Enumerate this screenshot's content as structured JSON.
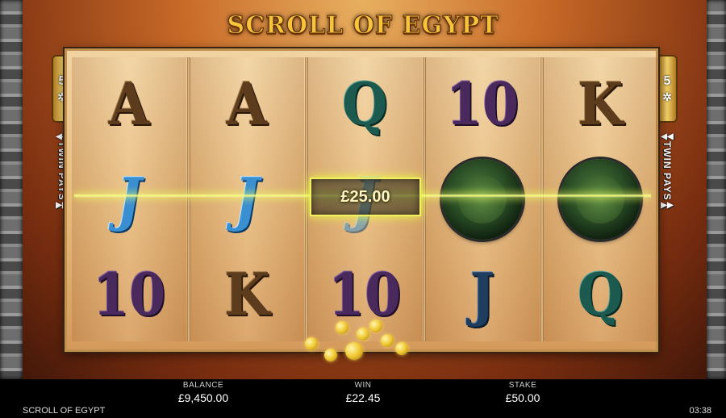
{
  "game": {
    "title": "SCROLL OF EGYPT",
    "lines_count": "5",
    "lines_star": "✲",
    "twin_pays_label": "TWIN PAYS",
    "arrow_up": "◀◀",
    "arrow_down": "▶▶"
  },
  "reels": [
    [
      "A",
      "J",
      "10"
    ],
    [
      "A",
      "J",
      "K"
    ],
    [
      "Q",
      "J",
      "10"
    ],
    [
      "10",
      "scarab-medallion",
      "J"
    ],
    [
      "K",
      "scarab-medallion",
      "Q"
    ]
  ],
  "win_popup": {
    "amount": "£25.00"
  },
  "hud": {
    "balance_label": "BALANCE",
    "balance_value": "£9,450.00",
    "win_label": "WIN",
    "win_value": "£22.45",
    "stake_label": "STAKE",
    "stake_value": "£50.00",
    "game_name": "SCROLL OF EGYPT",
    "clock": "03:38"
  },
  "colors": {
    "accent_gold": "#f7c33a",
    "payline": "#f4ff7a",
    "hud_bg": "#000000"
  }
}
